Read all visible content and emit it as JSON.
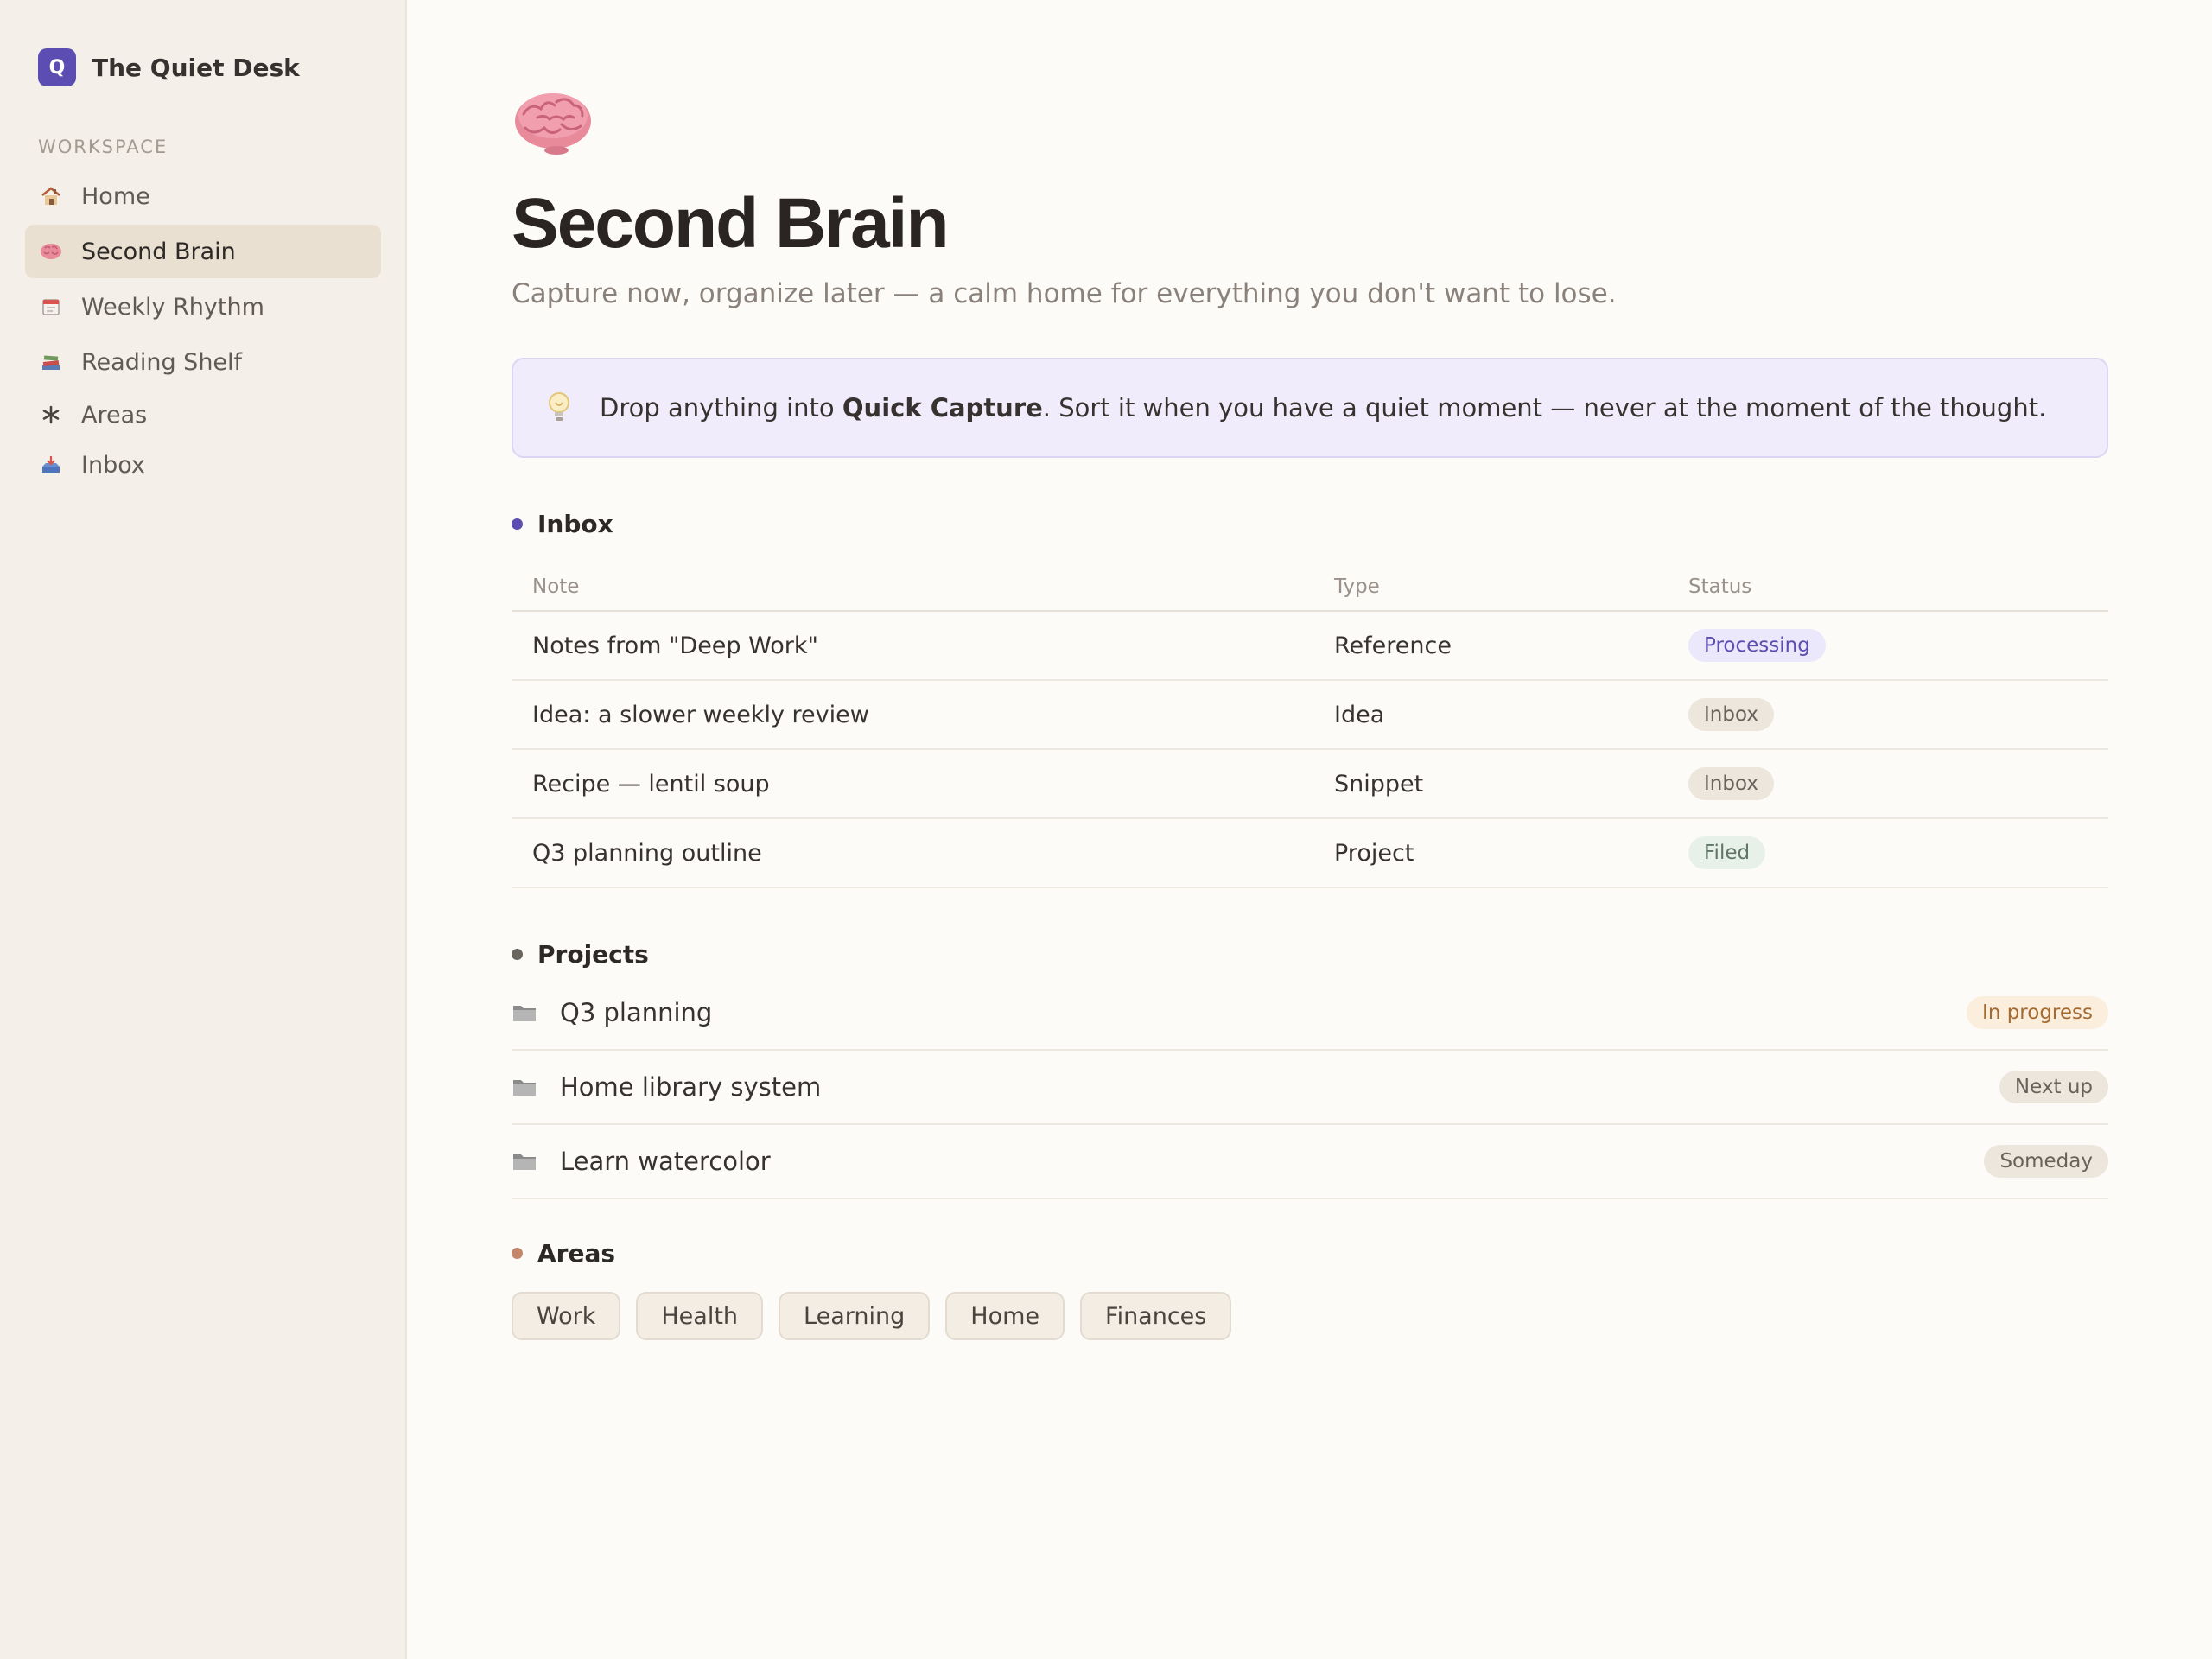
{
  "brand": {
    "logo_letter": "Q",
    "name": "The Quiet Desk"
  },
  "sidebar": {
    "section_label": "WORKSPACE",
    "items": [
      {
        "label": "Home",
        "icon": "house-icon",
        "active": false
      },
      {
        "label": "Second Brain",
        "icon": "brain-icon",
        "active": true
      },
      {
        "label": "Weekly Rhythm",
        "icon": "calendar-icon",
        "active": false
      },
      {
        "label": "Reading Shelf",
        "icon": "books-icon",
        "active": false
      },
      {
        "label": "Areas",
        "icon": "asterisk-icon",
        "active": false
      },
      {
        "label": "Inbox",
        "icon": "inbox-tray-icon",
        "active": false
      }
    ]
  },
  "page": {
    "icon": "brain-icon",
    "title": "Second Brain",
    "subtitle": "Capture now, organize later — a calm home for everything you don't want to lose."
  },
  "callout": {
    "icon": "lightbulb-icon",
    "text_before": "Drop anything into ",
    "text_bold": "Quick Capture",
    "text_after": ". Sort it when you have a quiet moment — never at the moment of the thought."
  },
  "inbox": {
    "title": "Inbox",
    "dot_color": "#5b4db1",
    "columns": [
      "Note",
      "Type",
      "Status"
    ],
    "rows": [
      {
        "note": "Notes from \"Deep Work\"",
        "type": "Reference",
        "status": "Processing"
      },
      {
        "note": "Idea: a slower weekly review",
        "type": "Idea",
        "status": "Inbox"
      },
      {
        "note": "Recipe — lentil soup",
        "type": "Snippet",
        "status": "Inbox"
      },
      {
        "note": "Q3 planning outline",
        "type": "Project",
        "status": "Filed"
      }
    ]
  },
  "projects": {
    "title": "Projects",
    "dot_color": "#6b6560",
    "items": [
      {
        "name": "Q3 planning",
        "status": "In progress",
        "icon": "folder-icon"
      },
      {
        "name": "Home library system",
        "status": "Next up",
        "icon": "folder-icon"
      },
      {
        "name": "Learn watercolor",
        "status": "Someday",
        "icon": "folder-icon"
      }
    ]
  },
  "areas": {
    "title": "Areas",
    "dot_color": "#c4876a",
    "items": [
      "Work",
      "Health",
      "Learning",
      "Home",
      "Finances"
    ]
  },
  "colors": {
    "accent": "#5b4db1",
    "sidebar_bg": "#f4efe8",
    "page_bg": "#fcfbf8",
    "callout_bg": "#f0ecfb"
  }
}
